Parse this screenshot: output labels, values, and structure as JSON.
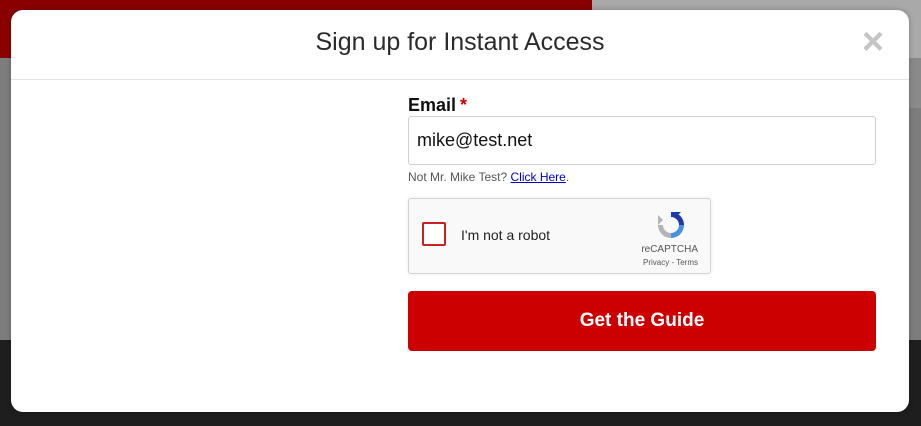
{
  "modal": {
    "title": "Sign up for Instant Access",
    "close_label": "×"
  },
  "form": {
    "email_label": "Email",
    "required_marker": "*",
    "email_value": "mike@test.net",
    "not_user_text": "Not Mr. Mike Test?",
    "not_user_link": "Click Here",
    "not_user_suffix": ".",
    "submit_label": "Get the Guide"
  },
  "recaptcha": {
    "label": "I'm not a robot",
    "brand": "reCAPTCHA",
    "privacy": "Privacy",
    "separator": " - ",
    "terms": "Terms"
  },
  "colors": {
    "accent": "#cc0000",
    "link": "#0000cc"
  },
  "icons": {
    "close": "close-icon",
    "recaptcha_logo": "recaptcha-logo-icon",
    "checkbox": "checkbox-icon"
  }
}
